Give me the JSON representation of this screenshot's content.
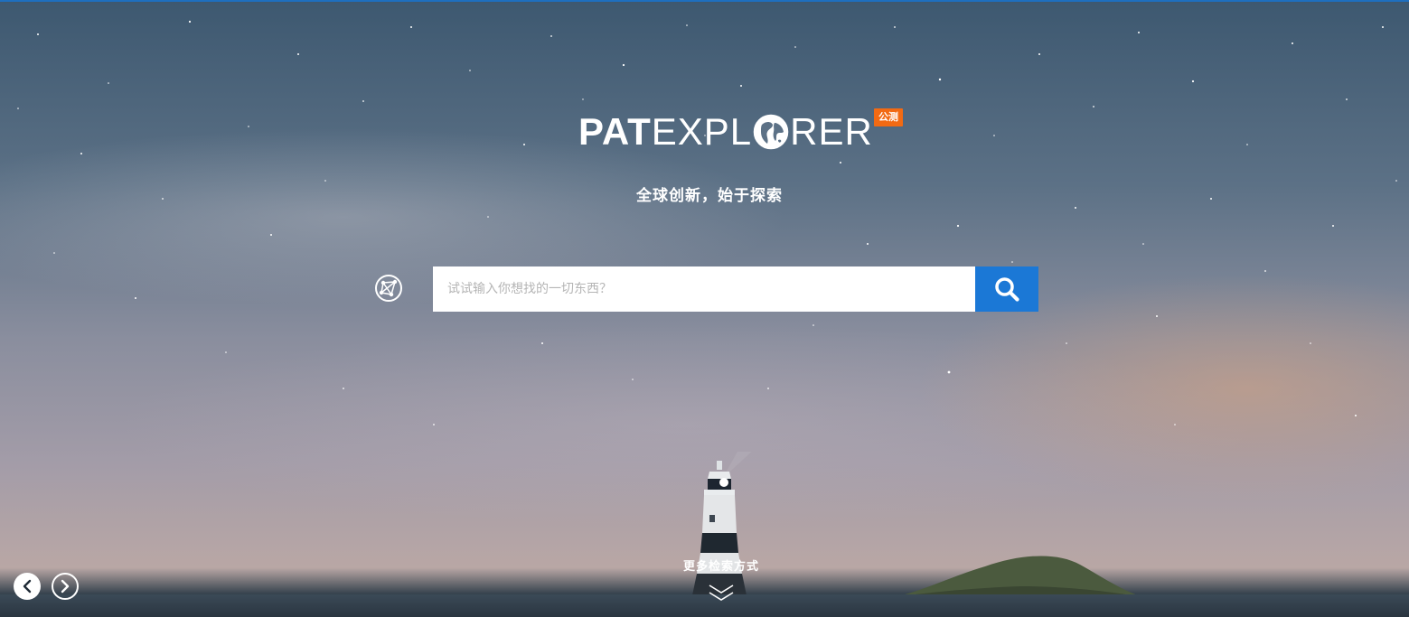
{
  "logo": {
    "bold_part": "PAT",
    "thin_part_1": "EXPL",
    "thin_part_2": "RER",
    "globe_icon": "globe-icon"
  },
  "badge": {
    "label": "公测",
    "color": "#f26a13"
  },
  "slogan": "全球创新，始于探索",
  "search": {
    "placeholder": "试试输入你想找的一切东西？",
    "value": "",
    "mode_icon": "search-mode-icon",
    "button_icon": "search-icon",
    "button_color": "#1b78d6"
  },
  "more_search": {
    "label": "更多检索方式",
    "icon": "chevron-down-icon"
  },
  "carousel": {
    "prev_icon": "chevron-left-icon",
    "next_icon": "chevron-right-icon"
  },
  "colors": {
    "accent": "#1b78d6",
    "top_border": "#1e6fbf"
  }
}
